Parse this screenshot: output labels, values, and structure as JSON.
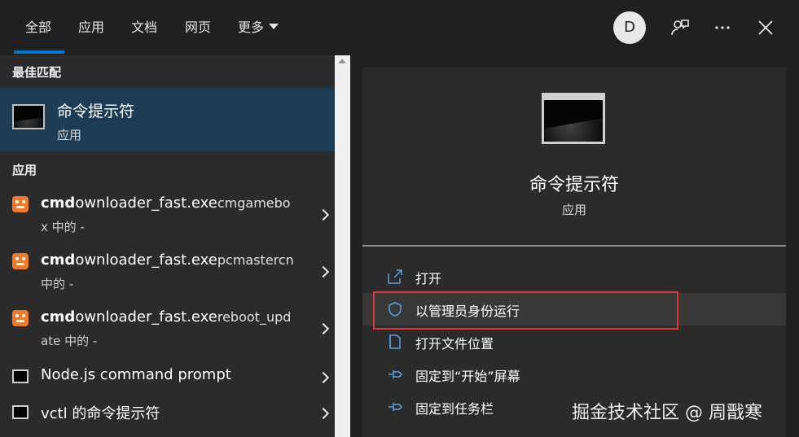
{
  "tabs": [
    {
      "label": "全部",
      "active": true
    },
    {
      "label": "应用"
    },
    {
      "label": "文档"
    },
    {
      "label": "网页"
    },
    {
      "label": "更多"
    }
  ],
  "header": {
    "avatar_letter": "D",
    "feedback_icon": "feedback-icon",
    "more_icon": "ellipsis-icon",
    "close_icon": "close-icon"
  },
  "left": {
    "best_match_header": "最佳匹配",
    "best_match": {
      "title": "命令提示符",
      "subtitle": "应用"
    },
    "apps_header": "应用",
    "apps": [
      {
        "bold": "cmd",
        "normal": "ownloader_fast.exe",
        "rest": "cmgamebo",
        "line2": "x 中的 -"
      },
      {
        "bold": "cmd",
        "normal": "ownloader_fast.exe",
        "rest": "pcmastercn",
        "line2": "中的 -"
      },
      {
        "bold": "cmd",
        "normal": "ownloader_fast.exe",
        "rest": "reboot_upd",
        "line2": "ate 中的 -"
      },
      {
        "name": "Node.js command prompt"
      },
      {
        "name": "vctl 的命令提示符"
      }
    ]
  },
  "right": {
    "title": "命令提示符",
    "subtitle": "应用",
    "actions": [
      {
        "label": "打开",
        "icon": "open-icon"
      },
      {
        "label": "以管理员身份运行",
        "icon": "shield-icon"
      },
      {
        "label": "打开文件位置",
        "icon": "folder-icon"
      },
      {
        "label": "固定到“开始”屏幕",
        "icon": "pin-icon"
      },
      {
        "label": "固定到任务栏",
        "icon": "pin-icon"
      }
    ]
  },
  "watermark": "掘金技术社区 @ 周戬寒",
  "colors": {
    "accent": "#0078d4",
    "selected_bg": "#1e3d55",
    "highlight_box": "#d9383a",
    "app_icon": "#f07a2a"
  }
}
